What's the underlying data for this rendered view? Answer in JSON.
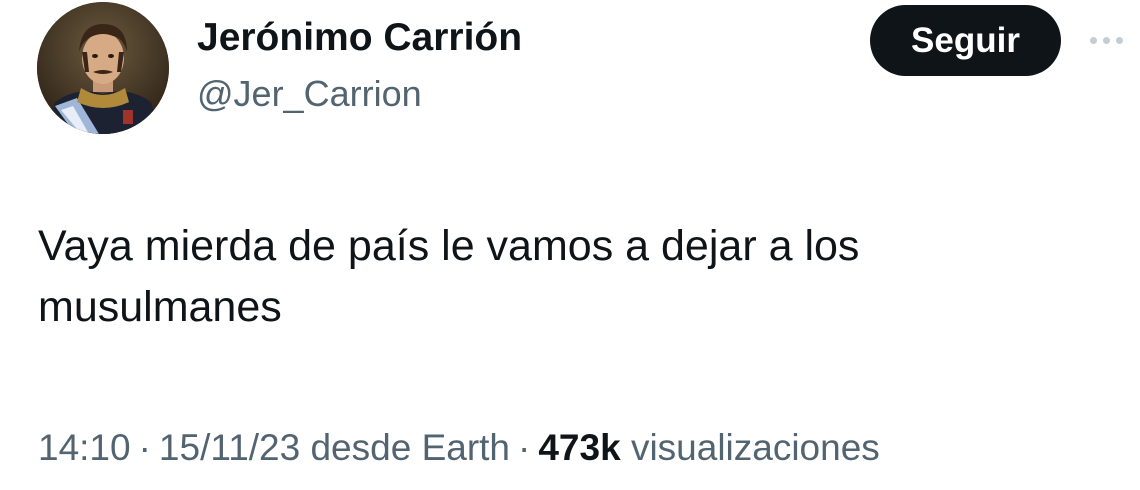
{
  "author": {
    "display_name": "Jerónimo Carrión",
    "handle": "@Jer_Carrion",
    "avatar_icon": "portrait-avatar-icon"
  },
  "actions": {
    "follow_label": "Seguir",
    "more_icon": "more-dots-icon"
  },
  "tweet": {
    "line1": "Vaya mierda de país le vamos a dejar a los",
    "line2": "musulmanes"
  },
  "meta": {
    "time": "14:10",
    "separator": "·",
    "date": "15/11/23",
    "source": "desde Earth",
    "views_count": "473k",
    "views_label": "visualizaciones"
  },
  "colors": {
    "text": "#0f1419",
    "secondary": "#536471",
    "button_bg": "#0f1419",
    "button_text": "#ffffff",
    "dots": "#c4cdd4"
  }
}
